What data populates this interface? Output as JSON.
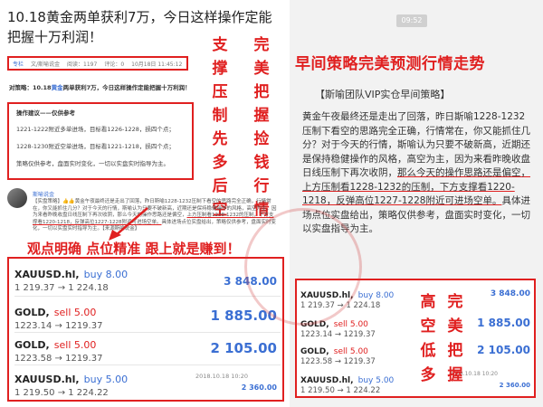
{
  "left": {
    "title": "10.18黄金两单获利7万，今日这样操作定能把握十万利润！",
    "meta": {
      "column": "专栏",
      "section": "文/斯喻说金",
      "reads": "阅读：1197",
      "comments": "评论：0",
      "date": "10月18日 11:45:12"
    },
    "summary": {
      "prefix": "对策略：",
      "date": "10.18",
      "mid": "黄金",
      "rest": "两单获利7万，今日这样操作定能把握十万利润！"
    },
    "advice": {
      "heading": "操作建议——仅供参考",
      "lines": [
        "1221-1222附近多单进场，目标看1226-1228，损四个点；",
        "1228-1230附近空单进场，目标看1221-1218，损四个点；",
        "策略仅供参考，盘面实时变化，一切以实盘实时指导为主。"
      ]
    },
    "side_labels": [
      "支",
      "完",
      "撑",
      "美",
      "压",
      "把",
      "制",
      "握",
      "先",
      "捡",
      "多",
      "钱",
      "后",
      "行",
      "空",
      "情"
    ],
    "post": {
      "author": "斯喻说金",
      "body_a": "【实盘策略】👍👍黄金午夜最终还是走出了回落，昨日斯喻1228-1232压制下看空的思路完全正确，行情常在，你又能抓住几分？对于今天的行情，斯喻认为只要不破新高，近期还是保持稳健操作的风格，高空为主，因为来看昨晚收盘日线压制下再次收阴，那么今天的操作思路还是偏空，",
      "body_b": "上方压制看1228-1232的压制，下方支撑看1220-1218，反弹高位1227-1228附近可进场空单。",
      "body_c": "具体进场点位实盘给出，策略仅供参考，盘面实时变化，一切以实盘实时指导为主。【来源斯喻说金】"
    },
    "callout": "观点明确 点位精准 跟上就是赚到！",
    "trades": [
      {
        "symbol": "XAUUSD.hl,",
        "action": "buy 8.00",
        "side": "buy",
        "price": "1 219.37 → 1 224.18",
        "profit": "3 848.00"
      },
      {
        "symbol": "GOLD,",
        "action": "sell 5.00",
        "side": "sell",
        "price": "1223.14 → 1219.37",
        "profit": "1 885.00"
      },
      {
        "symbol": "GOLD,",
        "action": "sell 5.00",
        "side": "sell",
        "price": "1223.58 → 1219.37",
        "profit": "2 105.00"
      },
      {
        "symbol": "XAUUSD.hl,",
        "action": "buy 5.00",
        "side": "buy",
        "price": "1 219.50 → 1 224.22",
        "profit": "2 360.00",
        "date": "2018.10.18 10:20"
      }
    ]
  },
  "right": {
    "time": "09:52",
    "headline": "早间策略完美预测行情走势",
    "vip": "【斯喻团队VIP实仓早间策略】",
    "para_a": "黄金午夜最终还是走出了回落，昨日斯喻1228-1232压制下看空的思路完全正确，行情常在，你又能抓住几分？对于今天的行情，斯喻认为只要不破新高，近期还是保持稳健操作的风格，高空为主，因为来看昨晚收盘日线压制下再次收阴，",
    "para_b": "那么今天的操作思路还是偏空，上方压制看1228-1232的压制，下方支撑看1220-1218，反弹高位1227-1228附近可进场空单。",
    "para_c": "具体进场点位实盘给出，策略仅供参考，盘面实时变化，一切以实盘指导为主。",
    "trades": [
      {
        "symbol": "XAUUSD.hl,",
        "action": "buy 8.00",
        "side": "buy",
        "price": "1 219.37 → 1 224.18",
        "profit": "3 848.00"
      },
      {
        "symbol": "GOLD,",
        "action": "sell 5.00",
        "side": "sell",
        "price": "1223.14 → 1219.37",
        "profit": "1 885.00"
      },
      {
        "symbol": "GOLD,",
        "action": "sell 5.00",
        "side": "sell",
        "price": "1223.58 → 1219.37",
        "profit": "2 105.00"
      },
      {
        "symbol": "XAUUSD.hl,",
        "action": "buy 5.00",
        "side": "buy",
        "price": "1 219.50 → 1 224.22",
        "profit": "2 360.00",
        "date": "2018.10.18 10:20"
      }
    ],
    "side_labels": [
      "高",
      "完",
      "空",
      "美",
      "低",
      "把",
      "多",
      "握"
    ]
  },
  "colors": {
    "accent_red": "#e02020",
    "link_blue": "#3b6fd3"
  }
}
